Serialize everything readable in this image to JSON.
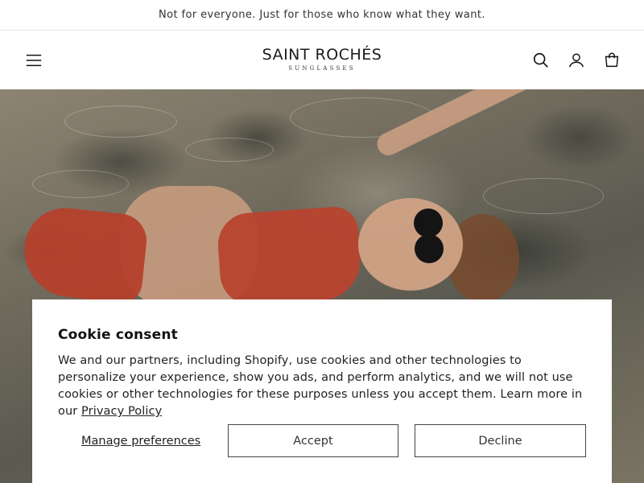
{
  "announcement": {
    "text": "Not for everyone. Just for those who know what they want."
  },
  "header": {
    "logo_main": "SAINT ROCHÉS",
    "logo_sub": "SUNGLASSES",
    "icons": [
      "menu-icon",
      "search-icon",
      "account-icon",
      "cart-icon"
    ]
  },
  "hero": {
    "description_icon": "hero-image"
  },
  "cookie": {
    "title": "Cookie consent",
    "body": "We and our partners, including Shopify, use cookies and other technologies to personalize your experience, show you ads, and perform analytics, and we will not use cookies or other technologies for these purposes unless you accept them. Learn more in our ",
    "privacy_link": "Privacy Policy",
    "manage_label": "Manage preferences",
    "accept_label": "Accept",
    "decline_label": "Decline"
  },
  "colors": {
    "accent_swimsuit": "#b8432f",
    "text": "#121212",
    "border": "#444444"
  }
}
